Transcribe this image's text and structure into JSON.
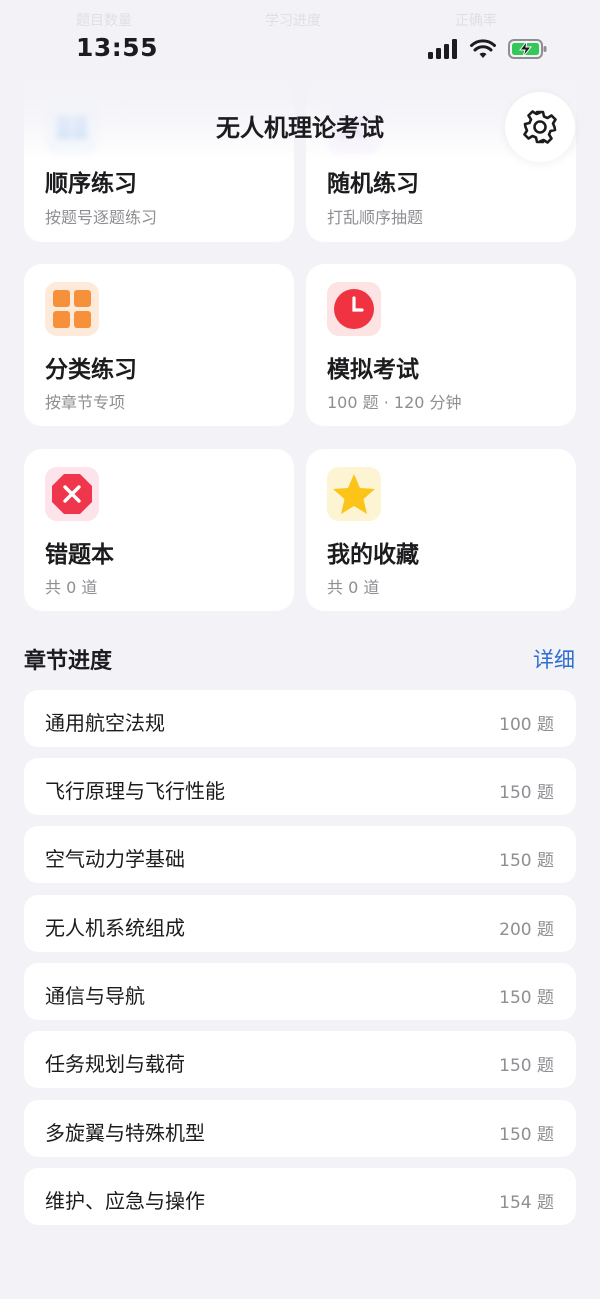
{
  "status_bar": {
    "time": "13:55",
    "ghost_tabs": [
      "题目数量",
      "学习进度",
      "正确率"
    ]
  },
  "header": {
    "title": "无人机理论考试",
    "settings_icon": "gear-icon"
  },
  "features": [
    {
      "title": "顺序练习",
      "subtitle": "按题号逐题练习",
      "icon": "book-icon",
      "icon_bg": "#e3eefc",
      "icon_color": "#5b9bf0"
    },
    {
      "title": "随机练习",
      "subtitle": "打乱顺序抽题",
      "icon": "shuffle-icon",
      "icon_bg": "#f1e4fb",
      "icon_color": "#b070e0"
    },
    {
      "title": "分类练习",
      "subtitle": "按章节专项",
      "icon": "grid-icon",
      "icon_bg": "#fdeadb",
      "icon_color": "#f7903b"
    },
    {
      "title": "模拟考试",
      "subtitle": "100 题 · 120 分钟",
      "icon": "clock-icon",
      "icon_bg": "#fde3e3",
      "icon_color": "#ef3340"
    },
    {
      "title": "错题本",
      "subtitle": "共 0 道",
      "icon": "x-octagon-icon",
      "icon_bg": "#fde3ea",
      "icon_color": "#f0364c"
    },
    {
      "title": "我的收藏",
      "subtitle": "共 0 道",
      "icon": "star-icon",
      "icon_bg": "#fdf4d3",
      "icon_color": "#fcc419"
    }
  ],
  "chapters": {
    "title": "章节进度",
    "detail_link": "详细",
    "items": [
      {
        "name": "通用航空法规",
        "count": "100 题"
      },
      {
        "name": "飞行原理与飞行性能",
        "count": "150 题"
      },
      {
        "name": "空气动力学基础",
        "count": "150 题"
      },
      {
        "name": "无人机系统组成",
        "count": "200 题"
      },
      {
        "name": "通信与导航",
        "count": "150 题"
      },
      {
        "name": "任务规划与载荷",
        "count": "150 题"
      },
      {
        "name": "多旋翼与特殊机型",
        "count": "150 题"
      },
      {
        "name": "维护、应急与操作",
        "count": "154 题"
      }
    ]
  },
  "colors": {
    "accent": "#2f6fd1",
    "background": "#f2f2f7",
    "card": "#ffffff",
    "battery_green": "#34c759"
  }
}
